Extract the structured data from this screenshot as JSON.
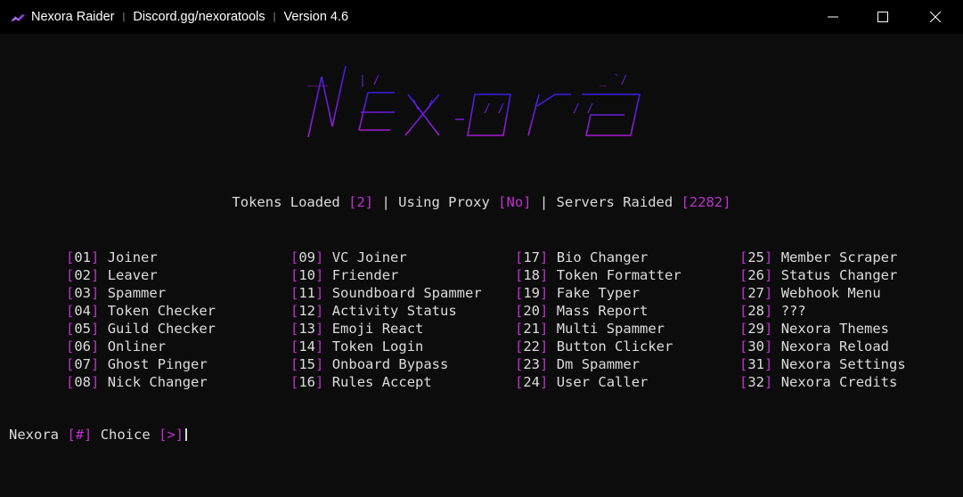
{
  "window": {
    "app_name": "Nexora Raider",
    "invite": "Discord.gg/nexoratools",
    "version": "Version 4.6",
    "separator": "|",
    "minimize_icon": "minimize-icon",
    "maximize_icon": "maximize-icon",
    "close_icon": "close-icon"
  },
  "banner": {
    "logo_text": "Nexora",
    "colors": [
      "#3a1ee6",
      "#6a1bd8",
      "#a01ccf"
    ]
  },
  "stats": {
    "tokens_label": "Tokens Loaded",
    "tokens_value": "2",
    "proxy_label": "Using Proxy",
    "proxy_value": "No",
    "servers_label": "Servers Raided",
    "servers_value": "2282"
  },
  "menu": {
    "columns": [
      [
        {
          "num": "01",
          "label": "Joiner"
        },
        {
          "num": "02",
          "label": "Leaver"
        },
        {
          "num": "03",
          "label": "Spammer"
        },
        {
          "num": "04",
          "label": "Token Checker"
        },
        {
          "num": "05",
          "label": "Guild Checker"
        },
        {
          "num": "06",
          "label": "Onliner"
        },
        {
          "num": "07",
          "label": "Ghost Pinger"
        },
        {
          "num": "08",
          "label": "Nick Changer"
        }
      ],
      [
        {
          "num": "09",
          "label": "VC Joiner"
        },
        {
          "num": "10",
          "label": "Friender"
        },
        {
          "num": "11",
          "label": "Soundboard Spammer"
        },
        {
          "num": "12",
          "label": "Activity Status"
        },
        {
          "num": "13",
          "label": "Emoji React"
        },
        {
          "num": "14",
          "label": "Token Login"
        },
        {
          "num": "15",
          "label": "Onboard Bypass"
        },
        {
          "num": "16",
          "label": "Rules Accept"
        }
      ],
      [
        {
          "num": "17",
          "label": "Bio Changer"
        },
        {
          "num": "18",
          "label": "Token Formatter"
        },
        {
          "num": "19",
          "label": "Fake Typer"
        },
        {
          "num": "20",
          "label": "Mass Report"
        },
        {
          "num": "21",
          "label": "Multi Spammer"
        },
        {
          "num": "22",
          "label": "Button Clicker"
        },
        {
          "num": "23",
          "label": "Dm Spammer"
        },
        {
          "num": "24",
          "label": "User Caller"
        }
      ],
      [
        {
          "num": "25",
          "label": "Member Scraper"
        },
        {
          "num": "26",
          "label": "Status Changer"
        },
        {
          "num": "27",
          "label": "Webhook Menu"
        },
        {
          "num": "28",
          "label": "???"
        },
        {
          "num": "29",
          "label": "Nexora Themes"
        },
        {
          "num": "30",
          "label": "Nexora Reload"
        },
        {
          "num": "31",
          "label": "Nexora Settings"
        },
        {
          "num": "32",
          "label": "Nexora Credits"
        }
      ]
    ]
  },
  "prompt": {
    "name": "Nexora",
    "hash": "#",
    "choice": "Choice",
    "arrow": ">"
  },
  "colors": {
    "bracket": "#c030d0",
    "text": "#dcdcdc",
    "background": "#0c0c0c"
  }
}
